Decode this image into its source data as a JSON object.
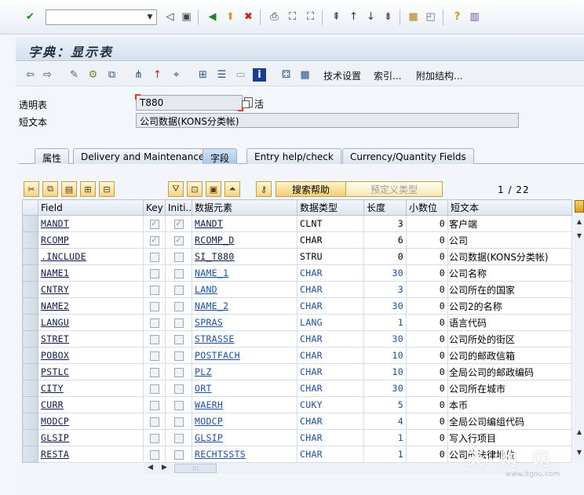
{
  "system_toolbar": {
    "command_value": "",
    "icons": [
      "enter-icon",
      "back-icon",
      "save-icon",
      "back-nav-icon",
      "exit-icon",
      "cancel-icon",
      "print-icon",
      "find-icon",
      "find-next-icon",
      "first-page-icon",
      "prev-page-icon",
      "next-page-icon",
      "last-page-icon",
      "new-session-icon",
      "shortcut-icon",
      "help-icon",
      "layout-icon"
    ]
  },
  "title": "字典：显示表",
  "app_toolbar": {
    "tech_settings": "技术设置",
    "index": "索引...",
    "append_structure": "附加结构..."
  },
  "header": {
    "table_label": "透明表",
    "table_value": "T880",
    "status": "活",
    "short_text_label": "短文本",
    "short_text_value": "公司数据(KONS分类帐)"
  },
  "tabs": [
    {
      "label": "属性"
    },
    {
      "label": "Delivery and Maintenance"
    },
    {
      "label": "字段"
    },
    {
      "label": "Entry help/check"
    },
    {
      "label": "Currency/Quantity Fields"
    }
  ],
  "table_toolbar": {
    "search_help": "搜索帮助",
    "predefined_type": "预定义类型",
    "pager": "1  /  22"
  },
  "columns": [
    "Field",
    "Key",
    "Initi...",
    "数据元素",
    "数据类型",
    "长度",
    "小数位",
    "短文本"
  ],
  "rows": [
    {
      "field": "MANDT",
      "key": true,
      "init": true,
      "element": "MANDT",
      "type": "CLNT",
      "len": "3",
      "dec": "0",
      "text": "客户端"
    },
    {
      "field": "RCOMP",
      "key": true,
      "init": true,
      "element": "RCOMP_D",
      "type": "CHAR",
      "len": "6",
      "dec": "0",
      "text": "公司"
    },
    {
      "field": ".INCLUDE",
      "key": false,
      "init": false,
      "element": "SI_T880",
      "type": "STRU",
      "len": "0",
      "dec": "0",
      "text": "公司数据(KONS分类帐)"
    },
    {
      "field": "NAME1",
      "key": false,
      "init": false,
      "element": "NAME_1",
      "type": "CHAR",
      "len": "30",
      "dec": "0",
      "text": "公司名称"
    },
    {
      "field": "CNTRY",
      "key": false,
      "init": false,
      "element": "LAND",
      "type": "CHAR",
      "len": "3",
      "dec": "0",
      "text": "公司所在的国家"
    },
    {
      "field": "NAME2",
      "key": false,
      "init": false,
      "element": "NAME_2",
      "type": "CHAR",
      "len": "30",
      "dec": "0",
      "text": "公司2的名称"
    },
    {
      "field": "LANGU",
      "key": false,
      "init": false,
      "element": "SPRAS",
      "type": "LANG",
      "len": "1",
      "dec": "0",
      "text": "语言代码"
    },
    {
      "field": "STRET",
      "key": false,
      "init": false,
      "element": "STRASSE",
      "type": "CHAR",
      "len": "30",
      "dec": "0",
      "text": "公司所处的街区"
    },
    {
      "field": "POBOX",
      "key": false,
      "init": false,
      "element": "POSTFACH",
      "type": "CHAR",
      "len": "10",
      "dec": "0",
      "text": "公司的邮政信箱"
    },
    {
      "field": "PSTLC",
      "key": false,
      "init": false,
      "element": "PLZ",
      "type": "CHAR",
      "len": "10",
      "dec": "0",
      "text": "全局公司的邮政编码"
    },
    {
      "field": "CITY",
      "key": false,
      "init": false,
      "element": "ORT",
      "type": "CHAR",
      "len": "30",
      "dec": "0",
      "text": "公司所在城市"
    },
    {
      "field": "CURR",
      "key": false,
      "init": false,
      "element": "WAERH",
      "type": "CUKY",
      "len": "5",
      "dec": "0",
      "text": "本币"
    },
    {
      "field": "MODCP",
      "key": false,
      "init": false,
      "element": "MODCP",
      "type": "CHAR",
      "len": "4",
      "dec": "0",
      "text": "全局公司编组代码"
    },
    {
      "field": "GLSIP",
      "key": false,
      "init": false,
      "element": "GLSIP",
      "type": "CHAR",
      "len": "1",
      "dec": "0",
      "text": "写入行项目"
    },
    {
      "field": "RESTA",
      "key": false,
      "init": false,
      "element": "RECHTSSTS",
      "type": "CHAR",
      "len": "1",
      "dec": "0",
      "text": "公司的法律地位"
    }
  ],
  "watermark": "天 购 网",
  "watermark_sub": "www.itgou.com"
}
